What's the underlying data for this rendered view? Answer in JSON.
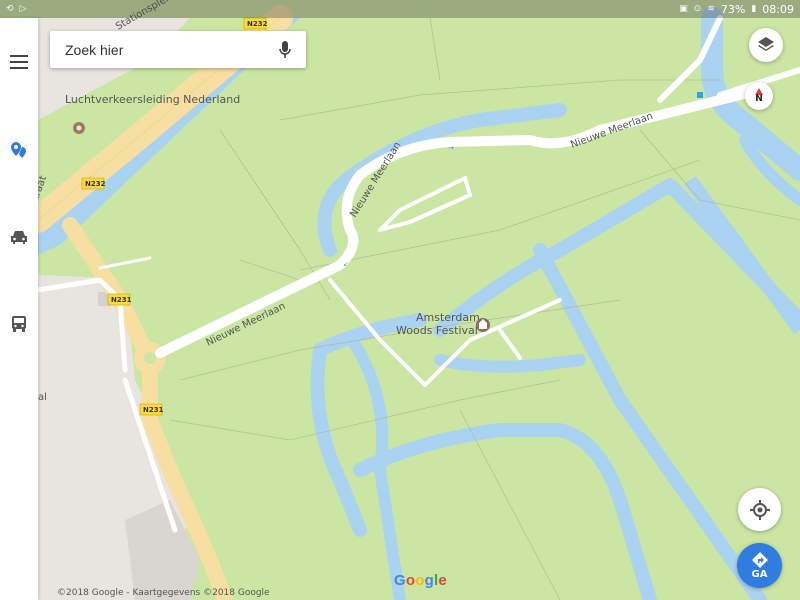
{
  "status_bar": {
    "battery": "73%",
    "time": "08:09"
  },
  "search": {
    "placeholder": "Zoek hier"
  },
  "compass": {
    "label": "N"
  },
  "go_button": {
    "label": "GA"
  },
  "map": {
    "places": {
      "lvnl": "Luchtverkeersleiding Nederland",
      "festival_line1": "Amsterdam",
      "festival_line2": "Woods Festival"
    },
    "roads": {
      "nieuwe_meerlaan": "Nieuwe Meerlaan",
      "stationsplein": "Stationsplein",
      "straat_fragment": "traat",
      "al_fragment": "al"
    },
    "road_shields": {
      "n232": "N232",
      "n231": "N231"
    },
    "colors": {
      "park": "#cbe6a3",
      "water": "#aad3f1",
      "road": "#ffffff",
      "highway": "#f6dfa0",
      "urban": "#e8e5e0",
      "accent": "#2f7de1"
    }
  },
  "copyright": "©2018 Google - Kaartgegevens ©2018 Google",
  "logo": [
    "G",
    "o",
    "o",
    "g",
    "l",
    "e"
  ]
}
